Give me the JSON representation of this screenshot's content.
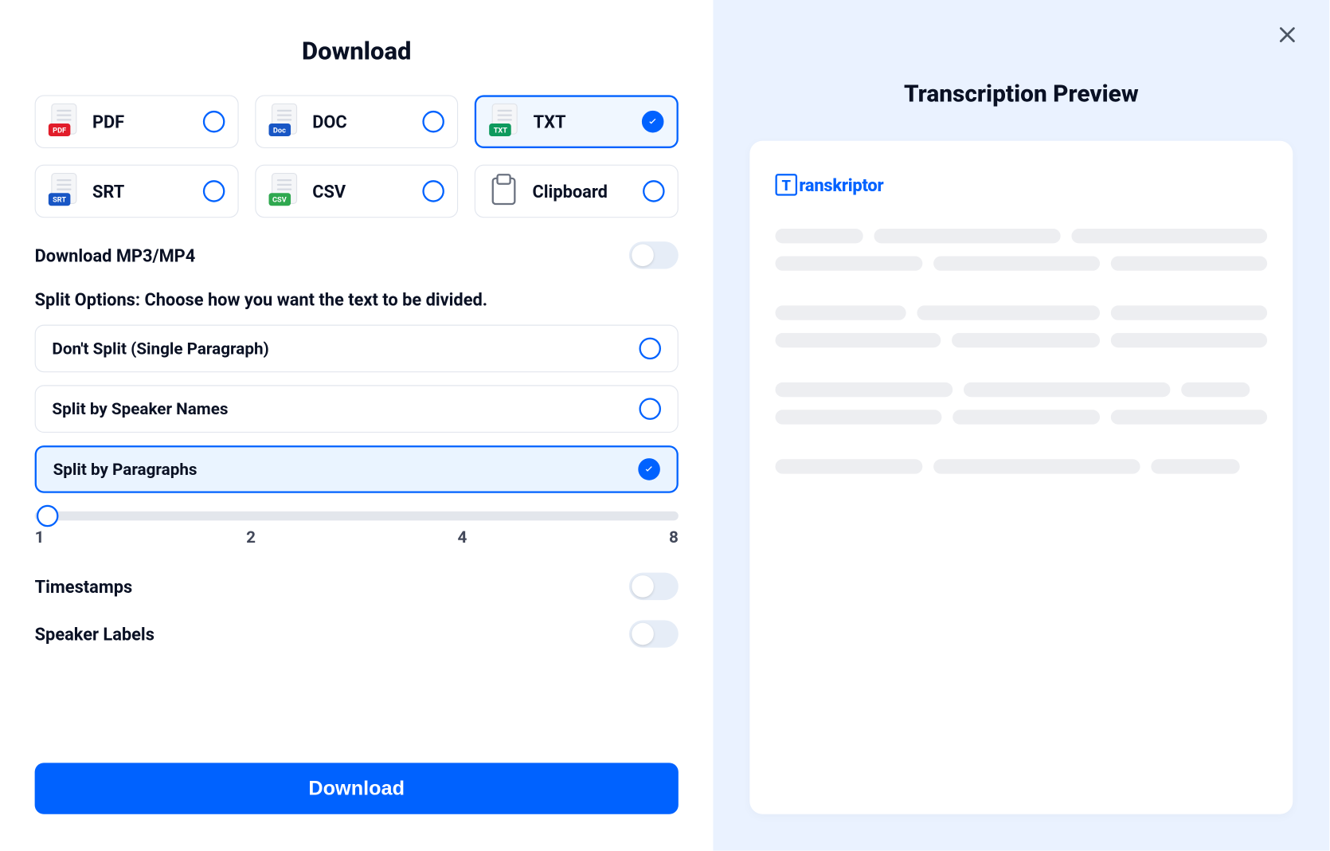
{
  "left": {
    "title": "Download",
    "formats": [
      {
        "label": "PDF",
        "tag": "PDF",
        "tagClass": "tag-pdf",
        "selected": false
      },
      {
        "label": "DOC",
        "tag": "Doc",
        "tagClass": "tag-doc",
        "selected": false
      },
      {
        "label": "TXT",
        "tag": "TXT",
        "tagClass": "tag-txt",
        "selected": true
      },
      {
        "label": "SRT",
        "tag": "SRT",
        "tagClass": "tag-srt",
        "selected": false
      },
      {
        "label": "CSV",
        "tag": "CSV",
        "tagClass": "tag-csv",
        "selected": false
      },
      {
        "label": "Clipboard",
        "tag": null,
        "selected": false
      }
    ],
    "mp3_label": "Download MP3/MP4",
    "mp3_on": false,
    "split_heading": "Split Options: Choose how you want the text to be divided.",
    "split_options": [
      {
        "label": "Don't Split (Single Paragraph)",
        "selected": false
      },
      {
        "label": "Split by Speaker Names",
        "selected": false
      },
      {
        "label": "Split by Paragraphs",
        "selected": true
      }
    ],
    "slider": {
      "value": 1,
      "ticks": [
        "1",
        "2",
        "4",
        "8"
      ]
    },
    "timestamps_label": "Timestamps",
    "timestamps_on": false,
    "speaker_labels_label": "Speaker Labels",
    "speaker_labels_on": false,
    "download_button": "Download"
  },
  "right": {
    "title": "Transcription Preview",
    "brand": "ranskriptor",
    "brand_letter": "T"
  }
}
